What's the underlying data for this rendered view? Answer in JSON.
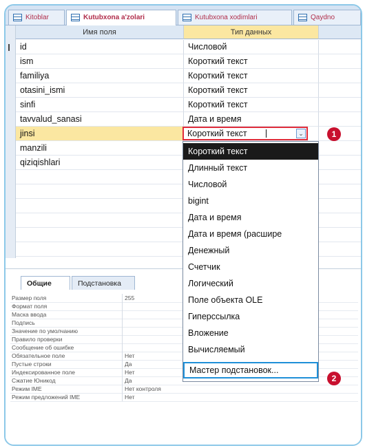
{
  "tabs": [
    {
      "label": "Kitoblar"
    },
    {
      "label": "Kutubxona a'zolari"
    },
    {
      "label": "Kutubxona xodimlari"
    },
    {
      "label": "Qaydno"
    }
  ],
  "grid": {
    "header_name": "Имя поля",
    "header_type": "Тип данных",
    "rows": [
      {
        "name": "id",
        "type": "Числовой"
      },
      {
        "name": "ism",
        "type": "Короткий текст"
      },
      {
        "name": "familiya",
        "type": "Короткий текст"
      },
      {
        "name": "otasini_ismi",
        "type": "Короткий текст"
      },
      {
        "name": "sinfi",
        "type": "Короткий текст"
      },
      {
        "name": "tavvalud_sanasi",
        "type": "Дата и время"
      },
      {
        "name": "jinsi",
        "type": ""
      },
      {
        "name": "manzili",
        "type": ""
      },
      {
        "name": "qiziqishlari",
        "type": ""
      }
    ],
    "selected_row": 6
  },
  "combo": {
    "value": "Короткий текст",
    "button_glyph": "⌄"
  },
  "dropdown": {
    "items": [
      "Короткий текст",
      "Длинный текст",
      "Числовой",
      "bigint",
      "Дата и время",
      "Дата и время (расшире",
      "Денежный",
      "Счетчик",
      "Логический",
      "Поле объекта OLE",
      "Гиперссылка",
      "Вложение",
      "Вычисляемый",
      "Мастер подстановок..."
    ],
    "highlighted": 0,
    "boxed": 13
  },
  "badges": {
    "one": "1",
    "two": "2"
  },
  "properties": {
    "tab_general": "Общие",
    "tab_lookup": "Подстановка",
    "rows": [
      {
        "label": "Размер поля",
        "value": "255"
      },
      {
        "label": "Формат поля",
        "value": ""
      },
      {
        "label": "Маска ввода",
        "value": ""
      },
      {
        "label": "Подпись",
        "value": ""
      },
      {
        "label": "Значение по умолчанию",
        "value": ""
      },
      {
        "label": "Правило проверки",
        "value": ""
      },
      {
        "label": "Сообщение об ошибке",
        "value": ""
      },
      {
        "label": "Обязательное поле",
        "value": "Нет"
      },
      {
        "label": "Пустые строки",
        "value": "Да"
      },
      {
        "label": "Индексированное поле",
        "value": "Нет"
      },
      {
        "label": "Сжатие Юникод",
        "value": "Да"
      },
      {
        "label": "Режим IME",
        "value": "Нет контроля"
      },
      {
        "label": "Режим предложений IME",
        "value": "Нет"
      }
    ]
  },
  "colors": {
    "accent_red": "#c8102e",
    "highlight_blue": "#1e8fd8",
    "selected_yellow": "#fbe7a1"
  }
}
